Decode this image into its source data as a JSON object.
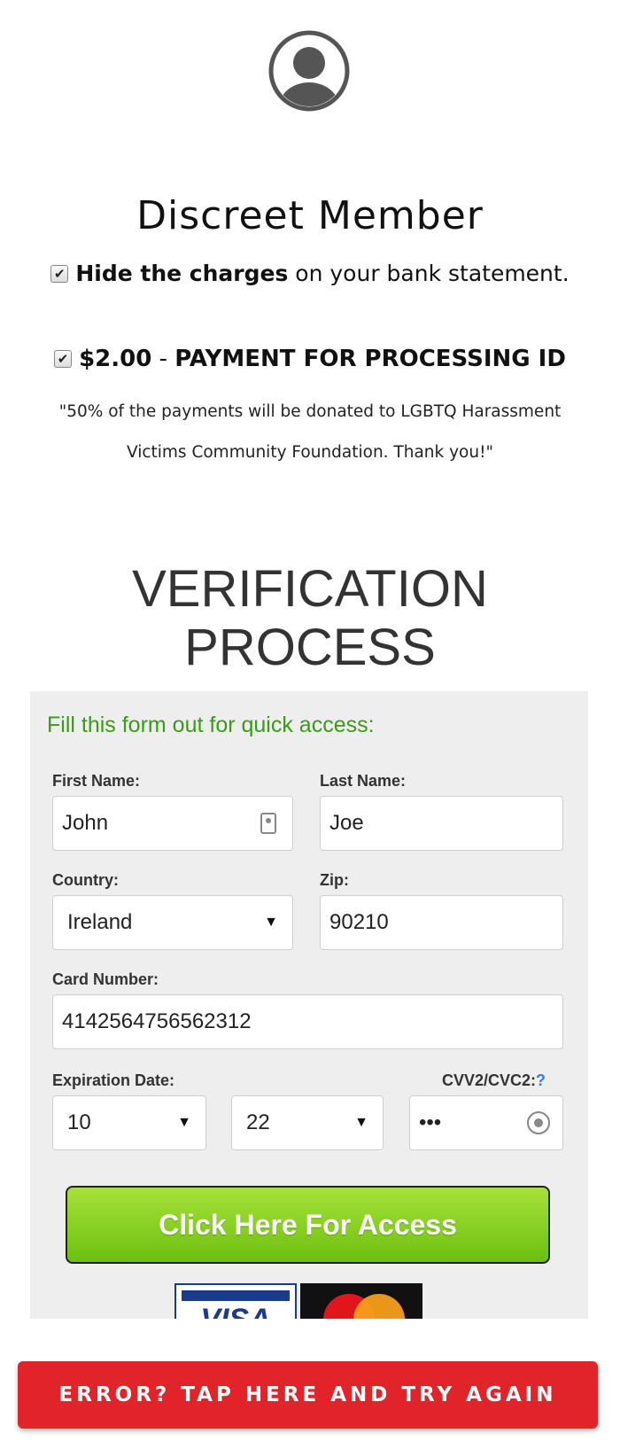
{
  "header": {
    "title": "Discreet Member",
    "hide_bold": "Hide the charges",
    "hide_rest": " on your bank statement.",
    "payment_amount": "$2.00",
    "payment_sep": " - ",
    "payment_desc": "PAYMENT FOR PROCESSING ID",
    "donation_note": "\"50% of the payments will be donated to LGBTQ Harassment Victims Community Foundation. Thank you!\""
  },
  "verification": {
    "title_line1": "VERIFICATION",
    "title_line2": "PROCESS"
  },
  "form": {
    "intro": "Fill this form out for quick access:",
    "first_name_label": "First Name:",
    "first_name_value": "John",
    "last_name_label": "Last Name:",
    "last_name_value": "Joe",
    "country_label": "Country:",
    "country_value": "Ireland",
    "zip_label": "Zip:",
    "zip_value": "90210",
    "card_label": "Card Number:",
    "card_value": "4142564756562312",
    "exp_label": "Expiration Date:",
    "exp_month": "10",
    "exp_year": "22",
    "cvv_label": "CVV2/CVC2:",
    "cvv_help": "?",
    "cvv_value": "•••",
    "submit_label": "Click Here For Access",
    "card_logos": [
      "VISA",
      "mastercard"
    ]
  },
  "error_button": "ERROR? TAP HERE AND TRY AGAIN",
  "colors": {
    "accent_green": "#3a9a1a",
    "button_green": "#8ad12a",
    "error_red": "#e0242a"
  },
  "icons": [
    "user-avatar-icon",
    "checkbox-checked-icon",
    "contact-card-icon",
    "dropdown-caret-icon",
    "key-icon"
  ]
}
